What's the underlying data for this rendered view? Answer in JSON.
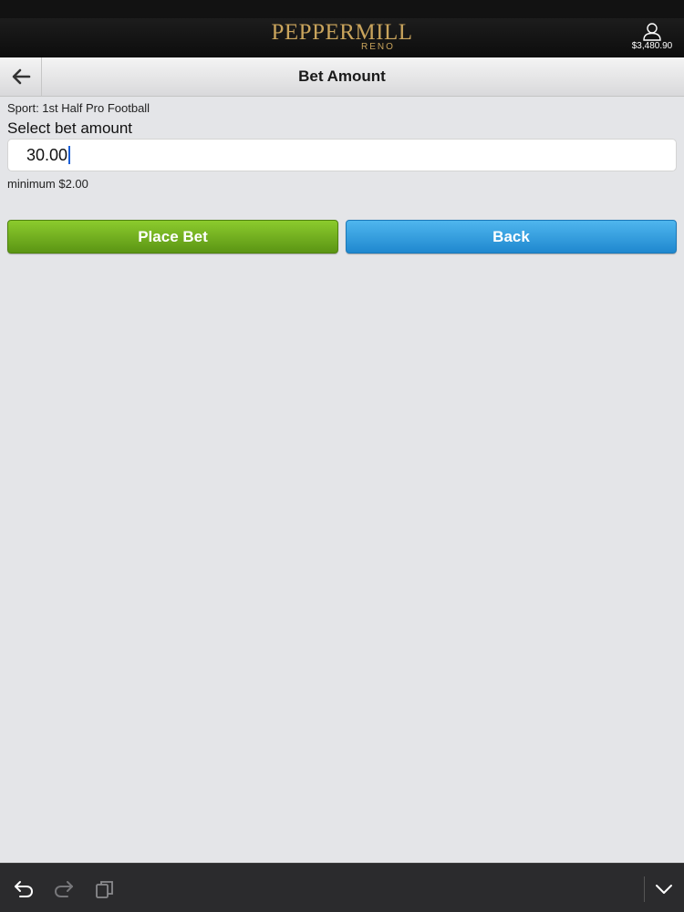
{
  "header": {
    "logo_text": "PEPPERMILL",
    "logo_subtext": "RENO",
    "account_icon": "user-icon",
    "balance": "$3,480.90"
  },
  "titlebar": {
    "back_icon": "arrow-left-icon",
    "title": "Bet Amount"
  },
  "form": {
    "sport_line": "Sport: 1st Half Pro Football",
    "select_label": "Select bet amount",
    "amount_value": "30.00",
    "minimum_note": "minimum $2.00"
  },
  "buttons": {
    "place_bet": "Place Bet",
    "back": "Back"
  },
  "bottombar": {
    "icons": [
      "undo-icon",
      "redo-icon",
      "copy-icon",
      "chevron-down-icon"
    ]
  },
  "colors": {
    "header_bg": "#0d0d0d",
    "logo_gold": "#c9a45c",
    "page_bg": "#e4e5e8",
    "place_bet_green": "#6fae1e",
    "back_blue": "#2f9ee0",
    "caret_blue": "#1b5fd6"
  }
}
